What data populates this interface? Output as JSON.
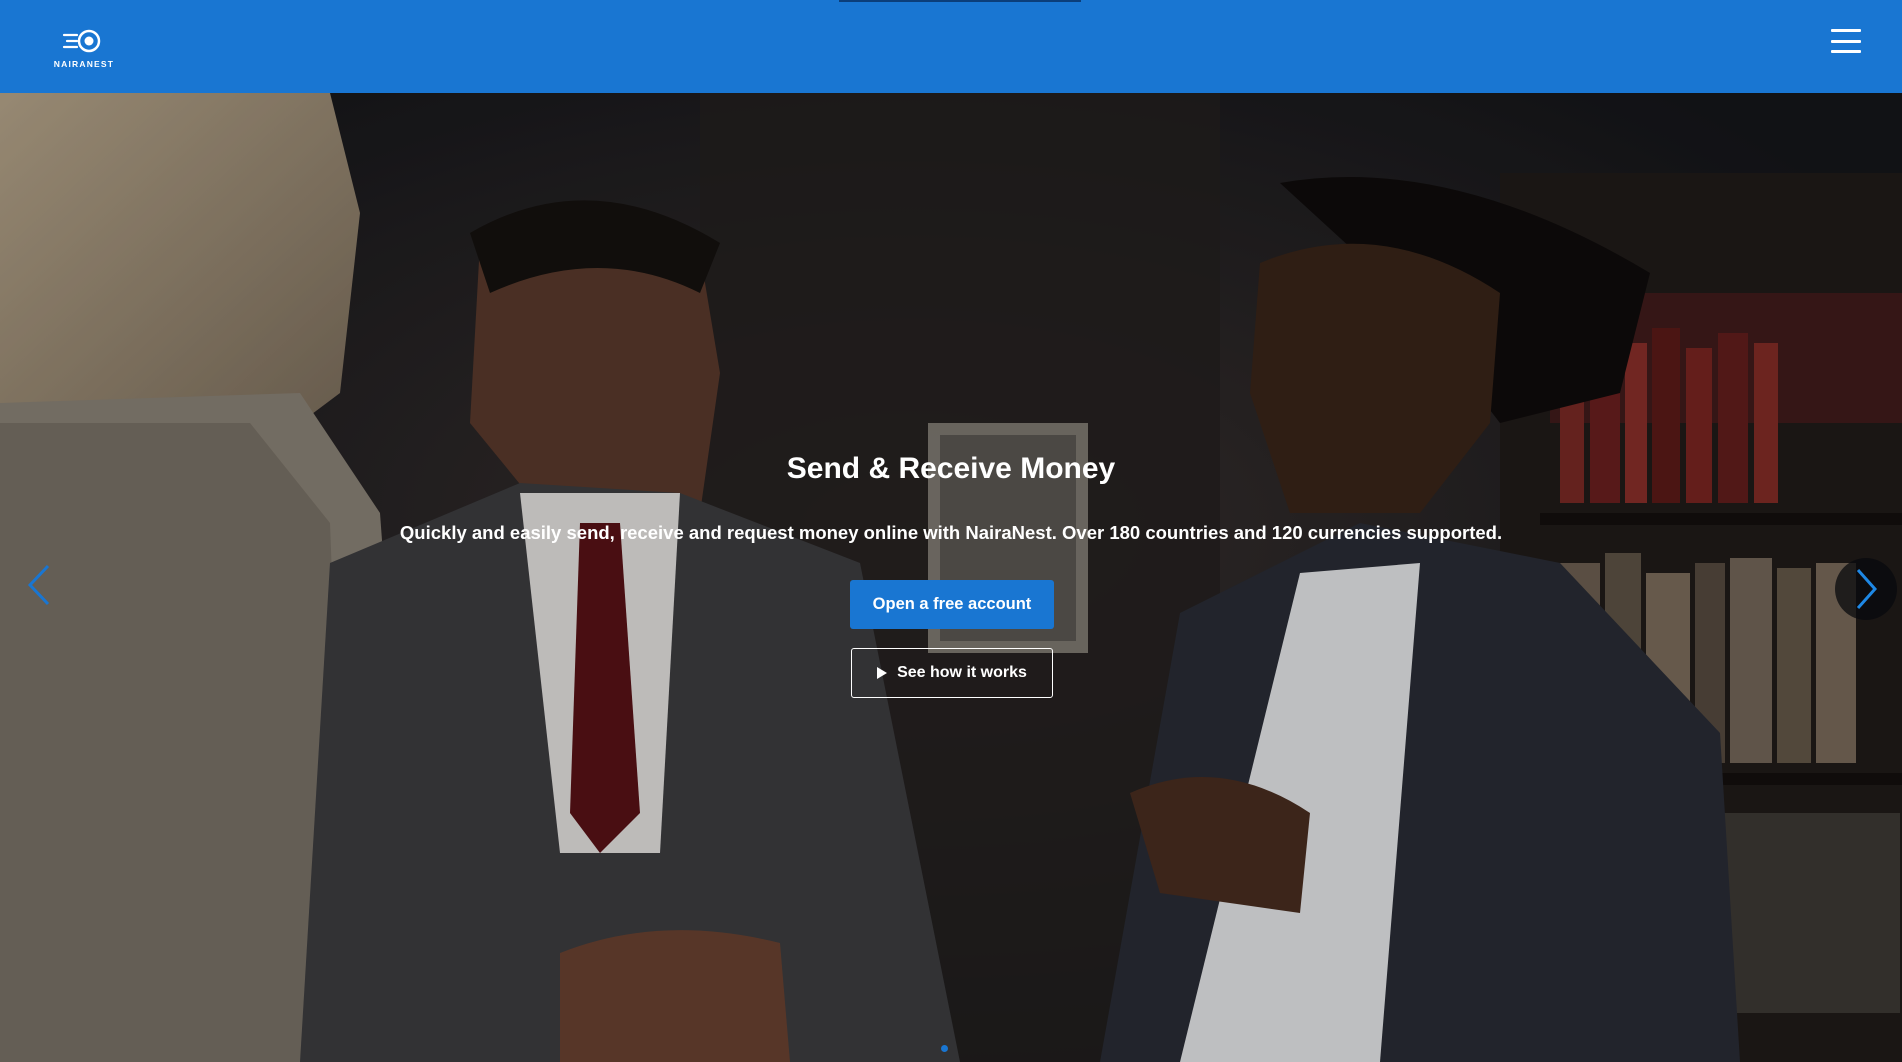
{
  "header": {
    "logo_text": "NAIRANEST",
    "menu_icon": "hamburger-menu-icon",
    "brand_color": "#1976d2"
  },
  "hero": {
    "title": "Send & Receive Money",
    "subtitle": "Quickly and easily send, receive and request money online with NairaNest. Over 180 countries and 120 currencies supported.",
    "primary_button": "Open a free account",
    "secondary_button": "See how it works",
    "secondary_icon": "play-icon",
    "prev_icon": "chevron-left-icon",
    "next_icon": "chevron-right-icon",
    "slides_count": 1,
    "active_slide": 1
  }
}
